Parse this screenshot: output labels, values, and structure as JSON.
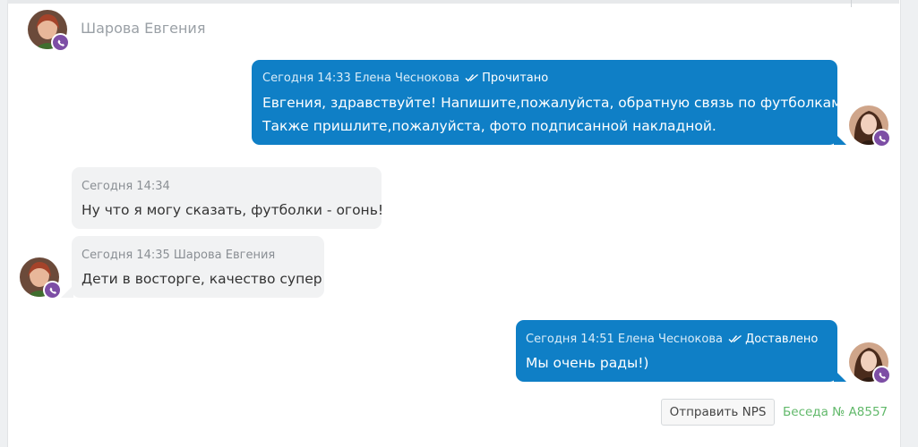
{
  "header": {
    "contact_name": "Шарова Евгения"
  },
  "messages": [
    {
      "direction": "outgoing",
      "time": "Сегодня 14:33",
      "author": "Елена Чеснокова",
      "status": "Прочитано",
      "lines": [
        "Евгения, здравствуйте! Напишите,пожалуйста, обратную связь по футболкам.",
        "Также пришлите,пожалуйста, фото подписанной накладной."
      ]
    },
    {
      "direction": "incoming",
      "time": "Сегодня 14:34",
      "author": "",
      "lines": [
        "Ну что я могу сказать, футболки - огонь!"
      ]
    },
    {
      "direction": "incoming",
      "time": "Сегодня 14:35",
      "author": "Шарова Евгения",
      "lines": [
        "Дети в восторге, качество супер"
      ]
    },
    {
      "direction": "outgoing",
      "time": "Сегодня 14:51",
      "author": "Елена Чеснокова",
      "status": "Доставлено",
      "lines": [
        "Мы очень рады!)"
      ]
    }
  ],
  "footer": {
    "nps_button_label": "Отправить NPS",
    "conversation_label": "Беседа № A8557"
  },
  "colors": {
    "outgoing_bubble": "#0f7fc6",
    "incoming_bubble": "#f1f2f3",
    "viber_badge": "#7d4ea5",
    "conversation_link": "#62b96b"
  },
  "icons": {
    "channel": "viber-icon",
    "read_status": "double-check-icon"
  }
}
